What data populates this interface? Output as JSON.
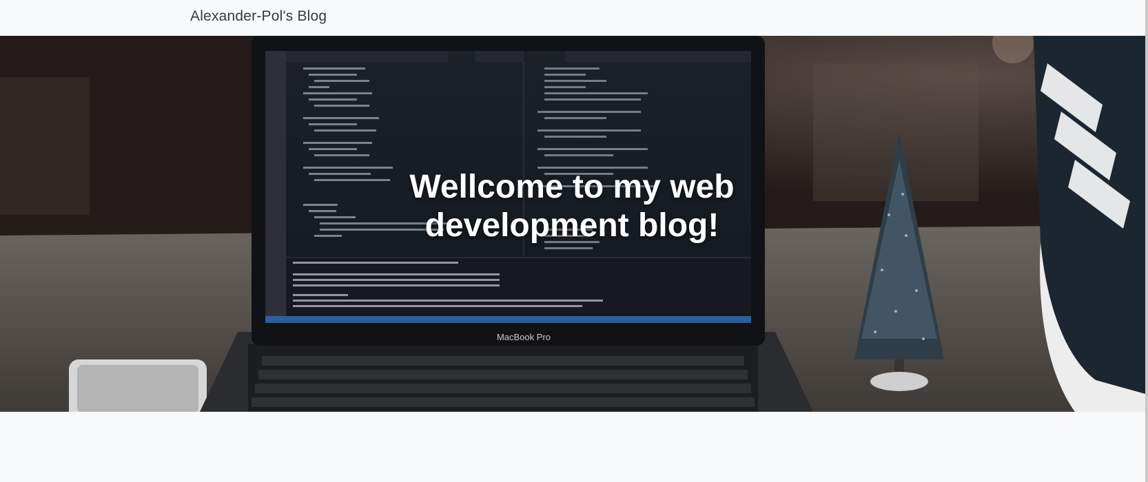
{
  "navbar": {
    "brand": "Alexander-Pol's Blog"
  },
  "hero": {
    "title": "Wellcome to my web development blog!",
    "laptop_label": "MacBook Pro"
  }
}
